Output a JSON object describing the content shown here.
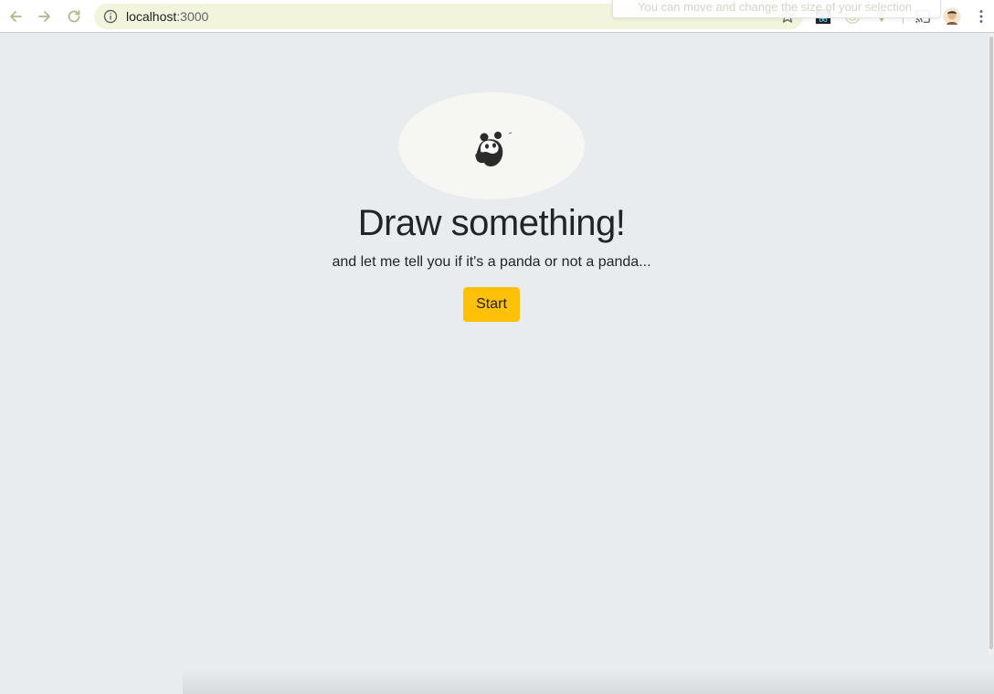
{
  "browser": {
    "url_host": "localhost",
    "url_port": ":3000",
    "tooltip_text": "You can move and change the size of your selection"
  },
  "icons": {
    "back": "arrow-left-icon",
    "forward": "arrow-right-icon",
    "reload": "reload-icon",
    "info": "info-icon",
    "bookmark": "star-icon",
    "ext_react": "react-devtools-icon",
    "ext_target": "target-extension-icon",
    "ext_vue": "vue-devtools-icon",
    "cast": "cast-icon",
    "profile": "avatar",
    "menu": "kebab-menu-icon",
    "hero": "panda-icon"
  },
  "colors": {
    "page_bg": "#e9ecef",
    "button_bg": "#ffc107",
    "omnibox_bg": "#f2f4dc",
    "text": "#212529"
  },
  "main": {
    "title": "Draw something!",
    "subtitle": "and let me tell you if it's a panda or not a panda...",
    "start_label": "Start"
  }
}
